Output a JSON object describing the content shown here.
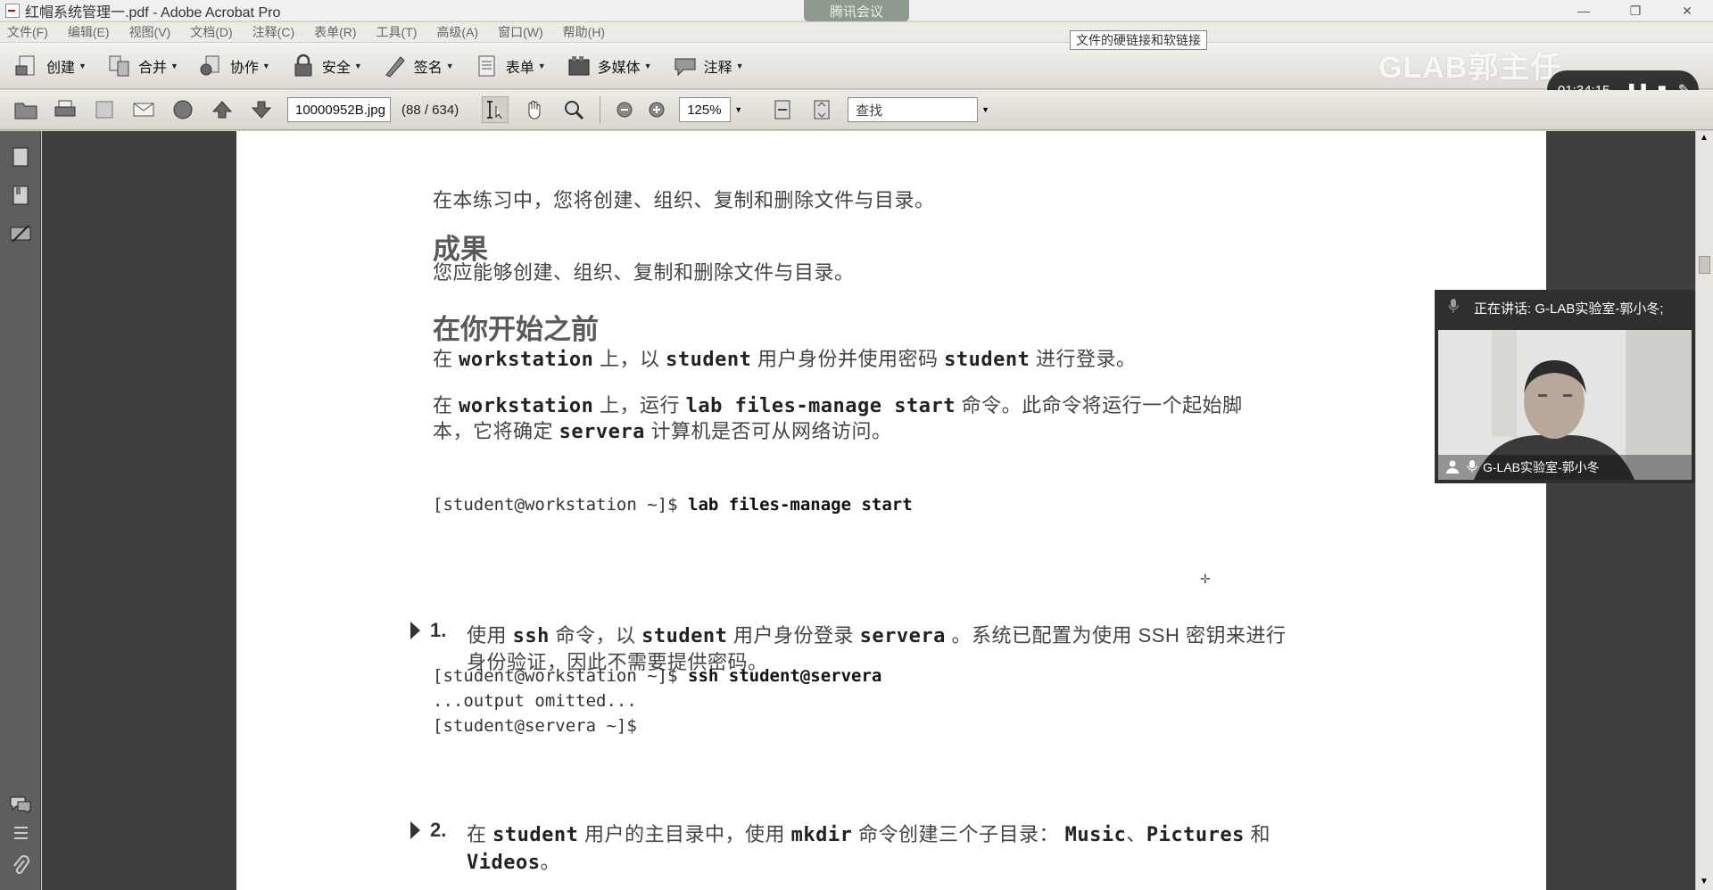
{
  "window": {
    "title": "红帽系统管理一.pdf - Adobe Acrobat Pro",
    "meeting_tab": "腾讯会议",
    "controls": [
      "—",
      "❐",
      "✕"
    ]
  },
  "menu": [
    "文件(F)",
    "编辑(E)",
    "视图(V)",
    "文档(D)",
    "注释(C)",
    "表单(R)",
    "工具(T)",
    "高级(A)",
    "窗口(W)",
    "帮助(H)"
  ],
  "tooltip": "文件的硬链接和软链接",
  "toolbar": {
    "buttons": [
      {
        "label": "创建",
        "icon": "create-icon"
      },
      {
        "label": "合并",
        "icon": "merge-icon"
      },
      {
        "label": "协作",
        "icon": "collaborate-icon"
      },
      {
        "label": "安全",
        "icon": "lock-icon"
      },
      {
        "label": "签名",
        "icon": "pen-icon"
      },
      {
        "label": "表单",
        "icon": "form-icon"
      },
      {
        "label": "多媒体",
        "icon": "multimedia-icon"
      },
      {
        "label": "注释",
        "icon": "comment-icon"
      }
    ]
  },
  "watermark": "GLAB郭主任",
  "recording": {
    "time": "01:34:15"
  },
  "nav": {
    "page_field": "10000952B.jpg",
    "page_count": "(88 / 634)",
    "zoom": "125%",
    "search_placeholder": "查找"
  },
  "document": {
    "intro": "在本练习中，您将创建、组织、复制和删除文件与目录。",
    "outcome_heading": "成果",
    "outcome_text": "您应能够创建、组织、复制和删除文件与目录。",
    "before_heading": "在你开始之前",
    "login_pre": "在",
    "login_host": "workstation",
    "login_mid": "上，以",
    "login_user": "student",
    "login_mid2": "用户身份并使用密码",
    "login_pass": "student",
    "login_post": "进行登录。",
    "run_pre": "在",
    "run_host": "workstation",
    "run_mid": "上，运行",
    "run_cmd": "lab files-manage start",
    "run_post": "命令。此命令将运行一个起始脚",
    "run_line2_pre": "本，它将确定",
    "run_line2_host": "servera",
    "run_line2_post": "计算机是否可从网络访问。",
    "cmd1_prompt": "[student@workstation ~]$",
    "cmd1_cmd": "lab files-manage start",
    "step1_num": "1.",
    "step1_pre": "使用",
    "step1_cmd": "ssh",
    "step1_mid": "命令，以",
    "step1_user": "student",
    "step1_mid2": "用户身份登录",
    "step1_host": "servera",
    "step1_post": "。系统已配置为使用 SSH 密钥来进行",
    "step1_line2": "身份验证，因此不需要提供密码。",
    "cmd2_prompt": "[student@workstation ~]$",
    "cmd2_cmd": "ssh student@servera",
    "cmd2_output": "...output omitted...",
    "cmd2_prompt2": "[student@servera ~]$",
    "step2_num": "2.",
    "step2_pre": "在",
    "step2_user": "student",
    "step2_mid": "用户的主目录中，使用",
    "step2_cmd": "mkdir",
    "step2_mid2": "命令创建三个子目录：",
    "step2_d1": "Music",
    "step2_sep": "、",
    "step2_d2": "Pictures",
    "step2_and": "和",
    "step2_d3": "Videos",
    "step2_end": "。"
  },
  "speaker": {
    "speaking": "正在讲话: G-LAB实验室-郭小冬;",
    "cam_name": "G-LAB实验室-郭小冬"
  }
}
